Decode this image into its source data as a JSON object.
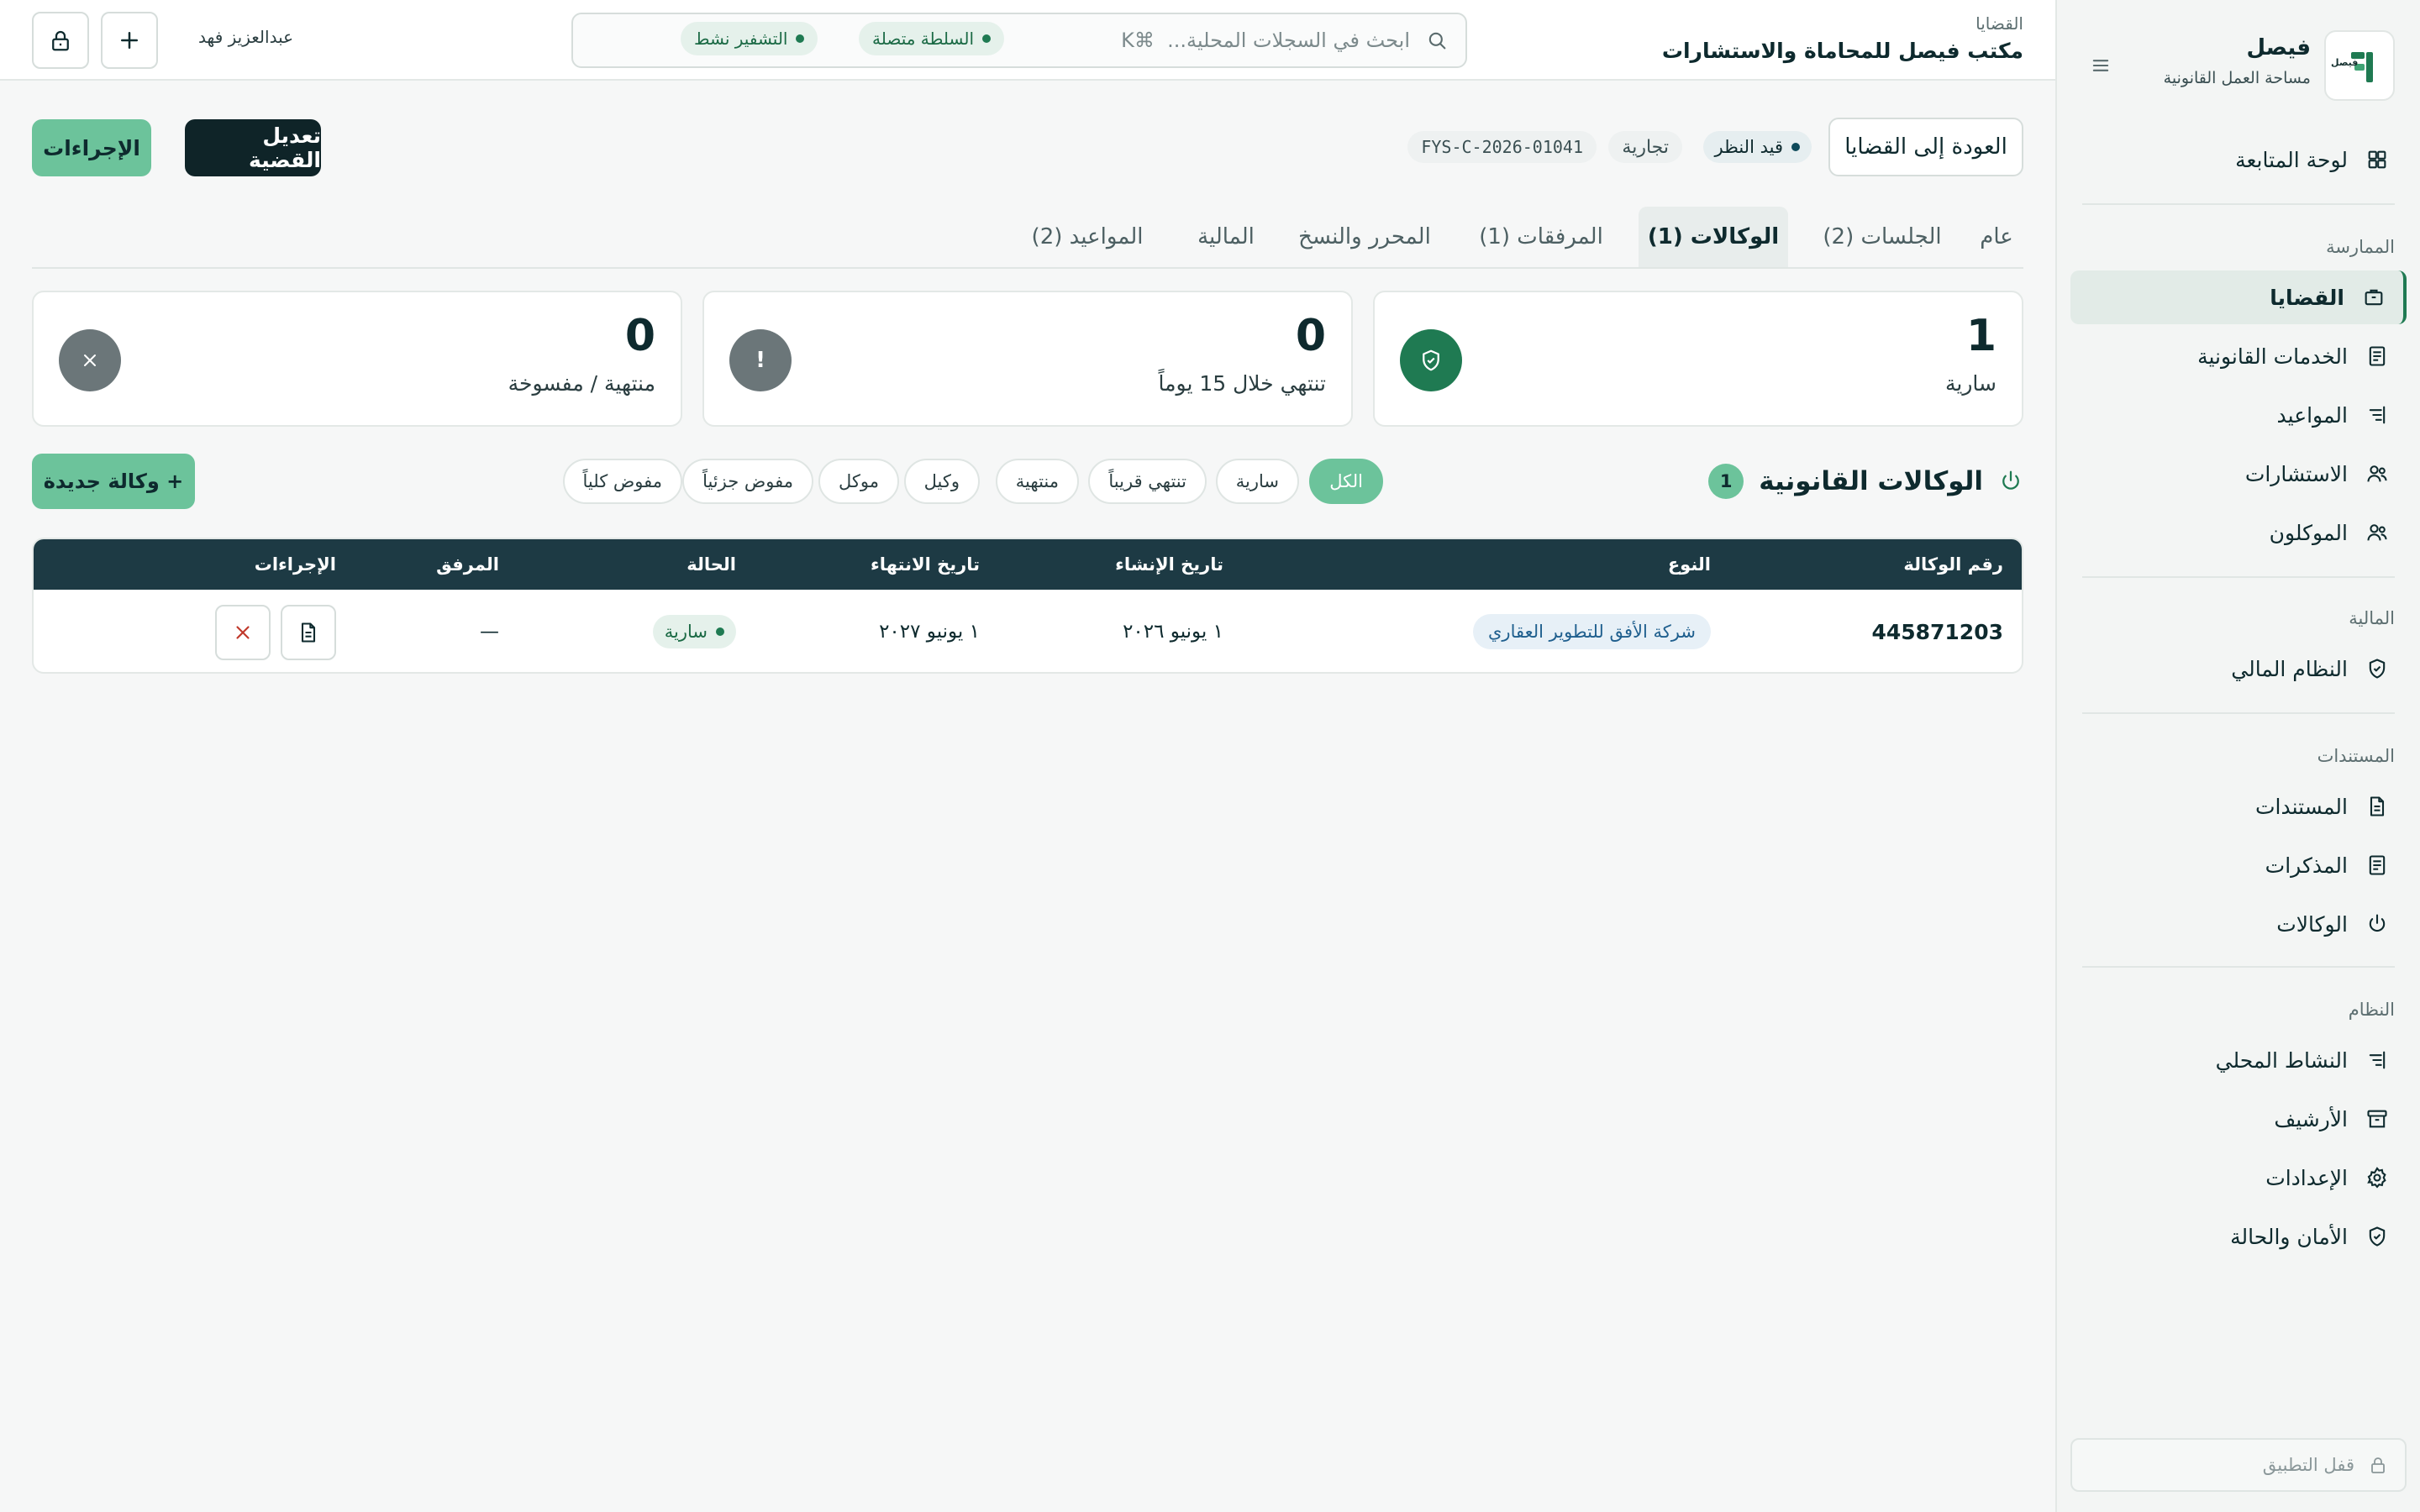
{
  "brand": {
    "name": "فيصل",
    "subtitle": "مساحة العمل القانونية",
    "logo_wordmark": "فيصل"
  },
  "sidebar": {
    "dashboard": "لوحة المتابعة",
    "sections": {
      "practice": "الممارسة",
      "finance": "المالية",
      "documents": "المستندات",
      "system": "النظام"
    },
    "items": {
      "cases": "القضايا",
      "legal_services": "الخدمات القانونية",
      "appointments": "المواعيد",
      "consultations": "الاستشارات",
      "clients": "الموكلون",
      "financial_system": "النظام المالي",
      "documents": "المستندات",
      "memos": "المذكرات",
      "powers_of_attorney": "الوكالات",
      "local_activity": "النشاط المحلي",
      "archive": "الأرشيف",
      "settings": "الإعدادات",
      "security_status": "الأمان والحالة"
    },
    "lock_app": "قفل التطبيق"
  },
  "topbar": {
    "breadcrumb": "القضايا",
    "firm_title": "مكتب فيصل للمحاماة والاستشارات",
    "search_placeholder": "ابحث في السجلات المحلية...  ⌘K",
    "status_authority": "السلطة متصلة",
    "status_encryption": "التشفير نشط",
    "user_name": "عبدالعزيز فهد"
  },
  "case": {
    "back_label": "العودة إلى القضايا",
    "status": "قيد النظر",
    "type": "تجارية",
    "code": "FYS-C-2026-01041",
    "edit_label": "تعديل القضية",
    "actions_label": "الإجراءات"
  },
  "tabs": [
    "عام",
    "الجلسات (2)",
    "الوكالات (1)",
    "المرفقات (1)",
    "المحرر والنسخ",
    "المالية",
    "المواعيد (2)"
  ],
  "active_tab": "الوكالات (1)",
  "stats": [
    {
      "value": "1",
      "label": "سارية",
      "color": "#1f7a52"
    },
    {
      "value": "0",
      "label": "تنتهي خلال 15 يوماً",
      "color": "#6b7679"
    },
    {
      "value": "0",
      "label": "منتهية / مفسوخة",
      "color": "#6b7679"
    }
  ],
  "poa": {
    "title": "الوكالات القانونية",
    "count": "1",
    "new_label": "+ وكالة جديدة",
    "filters": [
      "الكل",
      "سارية",
      "تنتهي قريباً",
      "منتهية",
      "وكيل",
      "موكل",
      "مفوض جزئياً",
      "مفوض كلياً"
    ],
    "active_filter": "الكل",
    "columns": {
      "number": "رقم الوكالة",
      "type": "النوع",
      "created": "تاريخ الإنشاء",
      "expiry": "تاريخ الانتهاء",
      "status": "الحالة",
      "attachment": "المرفق",
      "actions": "الإجراءات"
    },
    "rows": [
      {
        "number": "445871203",
        "type": "شركة الأفق للتطوير العقاري",
        "created": "١ يونيو ٢٠٢٦",
        "expiry": "١ يونيو ٢٠٢٧",
        "status": "سارية",
        "attachment": "—"
      }
    ]
  }
}
